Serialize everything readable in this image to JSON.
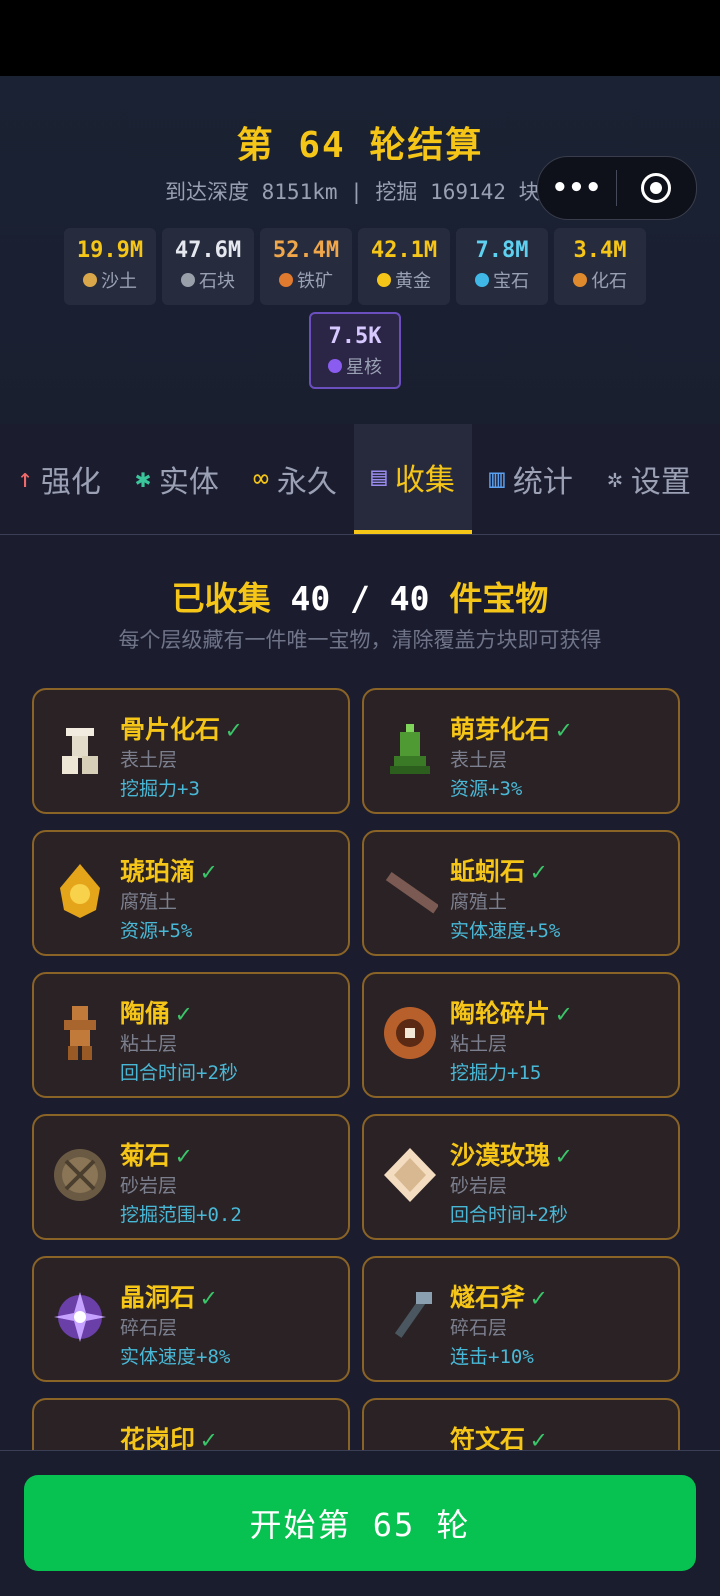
{
  "header": {
    "round_title": "第 64 轮结算",
    "summary": "到达深度 8151km | 挖掘 169142 块",
    "capsule_more": "•••",
    "resources": [
      {
        "value": "19.9M",
        "label": "沙土",
        "value_color": "#f5c518",
        "icon_color": "#d9a64a"
      },
      {
        "value": "47.6M",
        "label": "石块",
        "value_color": "#e6e8ef",
        "icon_color": "#9aa0aa"
      },
      {
        "value": "52.4M",
        "label": "铁矿",
        "value_color": "#f0a64a",
        "icon_color": "#e07a2e"
      },
      {
        "value": "42.1M",
        "label": "黄金",
        "value_color": "#f5c518",
        "icon_color": "#f5c518"
      },
      {
        "value": "7.8M",
        "label": "宝石",
        "value_color": "#5fd1f0",
        "icon_color": "#3fb8e8"
      },
      {
        "value": "3.4M",
        "label": "化石",
        "value_color": "#f5c518",
        "icon_color": "#e08a2e"
      },
      {
        "value": "7.5K",
        "label": "星核",
        "value_color": "#d7c8ff",
        "icon_color": "#8a5cf0"
      }
    ]
  },
  "tabs": [
    {
      "label": "强化",
      "icon": "↑",
      "icon_name": "arrow-up-icon",
      "icon_color": "#f06a6a"
    },
    {
      "label": "实体",
      "icon": "✱",
      "icon_name": "gear-green-icon",
      "icon_color": "#3ac59a"
    },
    {
      "label": "永久",
      "icon": "∞",
      "icon_name": "infinity-icon",
      "icon_color": "#f5c518"
    },
    {
      "label": "收集",
      "icon": "▤",
      "icon_name": "list-icon",
      "icon_color": "#9a8cf0",
      "active": true
    },
    {
      "label": "统计",
      "icon": "▥",
      "icon_name": "bar-chart-icon",
      "icon_color": "#5aa0f0"
    },
    {
      "label": "设置",
      "icon": "✲",
      "icon_name": "settings-icon",
      "icon_color": "#a0a4b8"
    }
  ],
  "collection": {
    "title_prefix": "已收集 ",
    "count": "40 / 40",
    "title_suffix": " 件宝物",
    "subtitle": "每个层级藏有一件唯一宝物，清除覆盖方块即可获得",
    "check": "✓",
    "items": [
      {
        "name": "骨片化石",
        "layer": "表土层",
        "bonus": "挖掘力+3",
        "icon_name": "bone-fossil-icon"
      },
      {
        "name": "萌芽化石",
        "layer": "表土层",
        "bonus": "资源+3%",
        "icon_name": "sprout-fossil-icon"
      },
      {
        "name": "琥珀滴",
        "layer": "腐殖土",
        "bonus": "资源+5%",
        "icon_name": "amber-drop-icon"
      },
      {
        "name": "蚯蚓石",
        "layer": "腐殖土",
        "bonus": "实体速度+5%",
        "icon_name": "worm-stone-icon"
      },
      {
        "name": "陶俑",
        "layer": "粘土层",
        "bonus": "回合时间+2秒",
        "icon_name": "clay-figure-icon"
      },
      {
        "name": "陶轮碎片",
        "layer": "粘土层",
        "bonus": "挖掘力+15",
        "icon_name": "pottery-wheel-icon"
      },
      {
        "name": "菊石",
        "layer": "砂岩层",
        "bonus": "挖掘范围+0.2",
        "icon_name": "ammonite-icon"
      },
      {
        "name": "沙漠玫瑰",
        "layer": "砂岩层",
        "bonus": "回合时间+2秒",
        "icon_name": "desert-rose-icon"
      },
      {
        "name": "晶洞石",
        "layer": "碎石层",
        "bonus": "实体速度+8%",
        "icon_name": "geode-icon"
      },
      {
        "name": "燧石斧",
        "layer": "碎石层",
        "bonus": "连击+10%",
        "icon_name": "flint-axe-icon"
      },
      {
        "name": "花岗印",
        "layer": "",
        "bonus": "",
        "icon_name": "granite-seal-icon"
      },
      {
        "name": "符文石",
        "layer": "",
        "bonus": "",
        "icon_name": "rune-stone-icon"
      }
    ]
  },
  "footer": {
    "start_label": "开始第 65 轮"
  }
}
